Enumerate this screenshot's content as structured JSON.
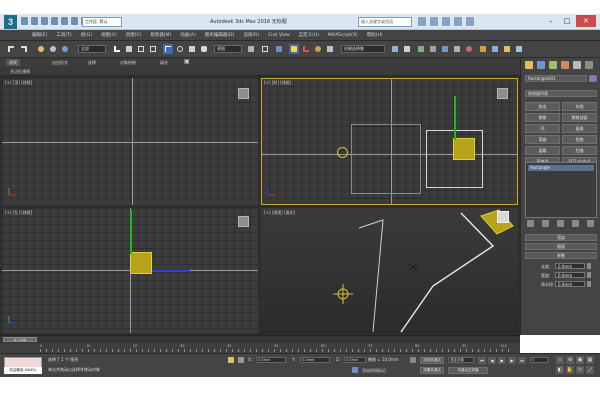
{
  "window": {
    "title": "Autodesk 3ds Max 2016    无标题",
    "workspace": "工作区: 默认",
    "search_placeholder": "键入关键字或短语",
    "controls": {
      "minimize": "–",
      "maximize": "□",
      "close": "✕"
    }
  },
  "menu": {
    "items": [
      "编辑(E)",
      "工具(T)",
      "组(G)",
      "视图(V)",
      "创建(C)",
      "修改器(M)",
      "动画(A)",
      "图形编辑器(D)",
      "渲染(R)",
      "Civil View",
      "自定义(U)",
      "MAXScript(X)",
      "帮助(H)"
    ]
  },
  "toolbar": {
    "filter_select": "全部",
    "view_select": "视图",
    "named_selection": "创建选择集"
  },
  "ribbon": {
    "tabs": [
      "建模",
      "自由形式",
      "选择",
      "对象绘制",
      "填充"
    ],
    "active_tab": "建模",
    "sub_label": "多边形建模"
  },
  "viewports": {
    "top": {
      "label": "[+] [顶] [线框]"
    },
    "front": {
      "label": "[+] [前] [线框]"
    },
    "left": {
      "label": "[+] [左] [线框]"
    },
    "perspective": {
      "label": "[+] [透视] [真实]"
    }
  },
  "command_panel": {
    "object_name": "Rectangle001",
    "modifier_list": "修改器列表",
    "modifier_buttons": [
      "挤出",
      "车削",
      "倒角",
      "倒角剖面",
      "壳",
      "晶格",
      "弯曲",
      "扭曲",
      "晶格",
      "扫描",
      "面挤出",
      "FFD 4x4x4"
    ],
    "stack_item": "Rectangle",
    "rollouts": {
      "render": "渲染",
      "interp": "插值",
      "params": "参数"
    },
    "params": [
      {
        "label": "长度:",
        "value": "0.0mm"
      },
      {
        "label": "宽度:",
        "value": "0.0mm"
      },
      {
        "label": "角半径:",
        "value": "0.0mm"
      }
    ]
  },
  "timeline": {
    "slider": "0 / 100",
    "ticks": [
      "0",
      "10",
      "20",
      "30",
      "40",
      "50",
      "60",
      "70",
      "80",
      "90",
      "100"
    ]
  },
  "status": {
    "maxscript_label": "欢迎使用 MAXSc",
    "selection_text": "选择了 1 个 图形",
    "prompt_text": "单击并拖动以选择并移动对象",
    "x_label": "X:",
    "x_value": "0.0mm",
    "y_label": "Y:",
    "y_value": "0.0mm",
    "z_label": "Z:",
    "z_value": "0.0mm",
    "grid_text": "栅格 = 10.0mm",
    "add_time_tag": "添加时间标记",
    "autokey": "自动关键点",
    "set_key": "设置关键点",
    "selected": "选定对象",
    "key_filters": "关键点过滤器",
    "frame": "0"
  },
  "colors": {
    "accent": "#3d6ab5",
    "active_viewport": "#c7a840",
    "object": "#b7a21a",
    "gizmo_x": "#d62020",
    "gizmo_y": "#1fb61f",
    "gizmo_z": "#2d3fd6"
  }
}
